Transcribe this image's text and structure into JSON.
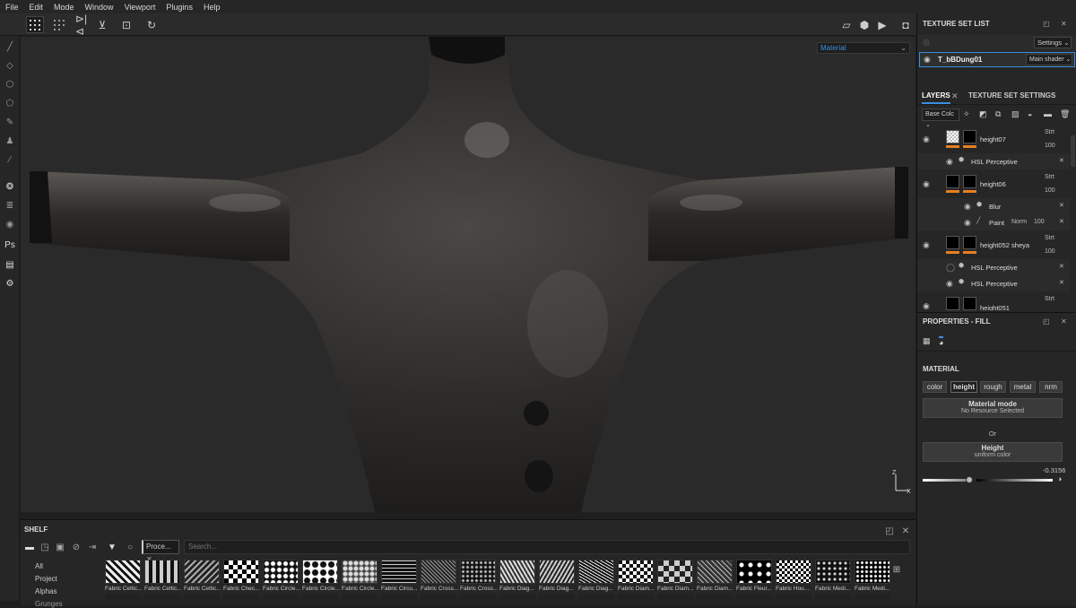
{
  "menu": [
    "File",
    "Edit",
    "Mode",
    "Window",
    "Viewport",
    "Plugins",
    "Help"
  ],
  "viewport": {
    "channel_select": "Material",
    "axis_labels": {
      "x": "X",
      "z": "Z"
    }
  },
  "texture_set_list": {
    "title": "TEXTURE SET LIST",
    "settings_label": "Settings",
    "item_name": "T_bBDung01",
    "shader_label": "Main shader"
  },
  "layers": {
    "tab_layers": "LAYERS",
    "tab_texture_settings": "TEXTURE SET SETTINGS",
    "channel_select": "Base Colc",
    "items": [
      {
        "name": "height07",
        "blend": "Strt",
        "opacity": "100"
      },
      {
        "name": "HSL Perceptive"
      },
      {
        "name": "height06",
        "blend": "Strt",
        "opacity": "100"
      },
      {
        "name": "Blur"
      },
      {
        "name": "Paint",
        "blend": "Norm",
        "opacity": "100"
      },
      {
        "name": "height052 sheya",
        "blend": "Strt",
        "opacity": "100"
      },
      {
        "name": "HSL Perceptive"
      },
      {
        "name": "HSL Perceptive"
      },
      {
        "name": "height051",
        "blend": "Strt"
      }
    ]
  },
  "properties": {
    "title": "PROPERTIES - FILL",
    "section": "MATERIAL",
    "channels": [
      "color",
      "height",
      "rough",
      "metal",
      "nrm"
    ],
    "selected_channel": "height",
    "material_mode_title": "Material mode",
    "material_mode_sub": "No Resource Selected",
    "or_label": "Or",
    "height_title": "Height",
    "height_sub": "uniform color",
    "height_value": "-0.3156",
    "height_slider_fraction": 0.35
  },
  "shelf": {
    "title": "SHELF",
    "filter_chip": "Proce...",
    "search_placeholder": "Search...",
    "categories": [
      "All",
      "Project",
      "Alphas",
      "Grunges"
    ],
    "thumbs": [
      "Fabric Celtic...",
      "Fabric Celtic...",
      "Fabric Celtic...",
      "Fabric Chec...",
      "Fabric Circle...",
      "Fabric Circle...",
      "Fabric Circle...",
      "Fabric Circu...",
      "Fabric Cross...",
      "Fabric Cross...",
      "Fabric Diag...",
      "Fabric Diag...",
      "Fabric Diag...",
      "Fabric Diam...",
      "Fabric Diam...",
      "Fabric Diam...",
      "Fabric Fleur...",
      "Fabric Hou...",
      "Fabric Medi...",
      "Fabric Medi..."
    ]
  },
  "colors": {
    "accent": "#3a8fe0",
    "mask_orange": "#e67e22"
  }
}
